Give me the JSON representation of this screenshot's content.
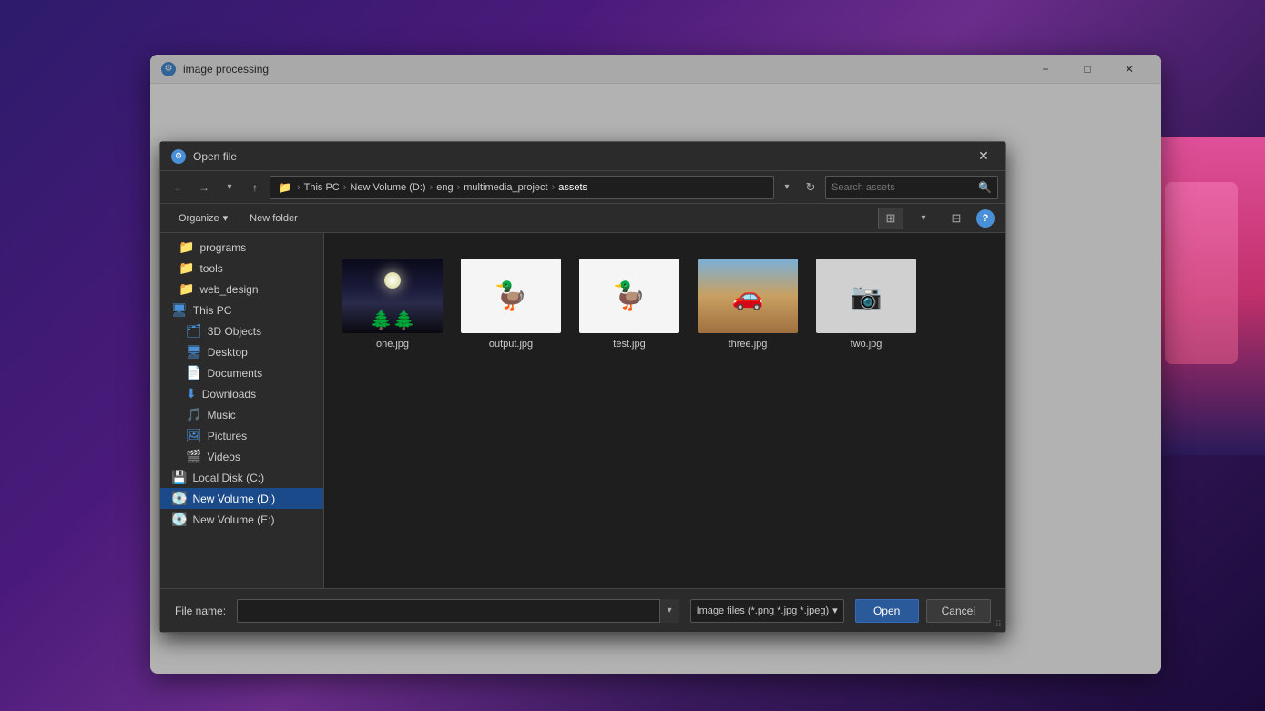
{
  "background": {
    "gradient": "purple"
  },
  "main_window": {
    "title": "image processing",
    "icon": "⚙",
    "controls": {
      "minimize": "−",
      "maximize": "□",
      "close": "✕"
    }
  },
  "dialog": {
    "title": "Open file",
    "icon": "⚙",
    "close": "✕",
    "nav": {
      "back": "←",
      "forward": "→",
      "recent": "⌄",
      "up": "↑",
      "folder_icon": "📁"
    },
    "breadcrumb": {
      "root_icon": "📁",
      "items": [
        "This PC",
        "New Volume (D:)",
        "eng",
        "multimedia_project",
        "assets"
      ]
    },
    "search_placeholder": "Search assets",
    "toolbar": {
      "organize": "Organize",
      "organize_arrow": "▾",
      "new_folder": "New folder"
    },
    "sidebar": {
      "folders": [
        {
          "name": "programs",
          "type": "folder-yellow"
        },
        {
          "name": "tools",
          "type": "folder-yellow"
        },
        {
          "name": "web_design",
          "type": "folder-yellow"
        }
      ],
      "this_pc": "This PC",
      "this_pc_items": [
        {
          "name": "3D Objects",
          "type": "special"
        },
        {
          "name": "Desktop",
          "type": "special"
        },
        {
          "name": "Documents",
          "type": "special"
        },
        {
          "name": "Downloads",
          "type": "downloads"
        },
        {
          "name": "Music",
          "type": "music"
        },
        {
          "name": "Pictures",
          "type": "pictures"
        },
        {
          "name": "Videos",
          "type": "videos"
        },
        {
          "name": "Local Disk (C:)",
          "type": "drive"
        },
        {
          "name": "New Volume (D:)",
          "type": "drive",
          "selected": true
        },
        {
          "name": "New Volume (E:)",
          "type": "drive"
        }
      ]
    },
    "files": [
      {
        "name": "one.jpg",
        "thumb": "one"
      },
      {
        "name": "output.jpg",
        "thumb": "output"
      },
      {
        "name": "test.jpg",
        "thumb": "test"
      },
      {
        "name": "three.jpg",
        "thumb": "three"
      },
      {
        "name": "two.jpg",
        "thumb": "two"
      }
    ],
    "bottom": {
      "file_name_label": "File name:",
      "file_name_value": "",
      "file_type": "Image files (*.png *.jpg *.jpeg)",
      "open_btn": "Open",
      "cancel_btn": "Cancel"
    }
  }
}
